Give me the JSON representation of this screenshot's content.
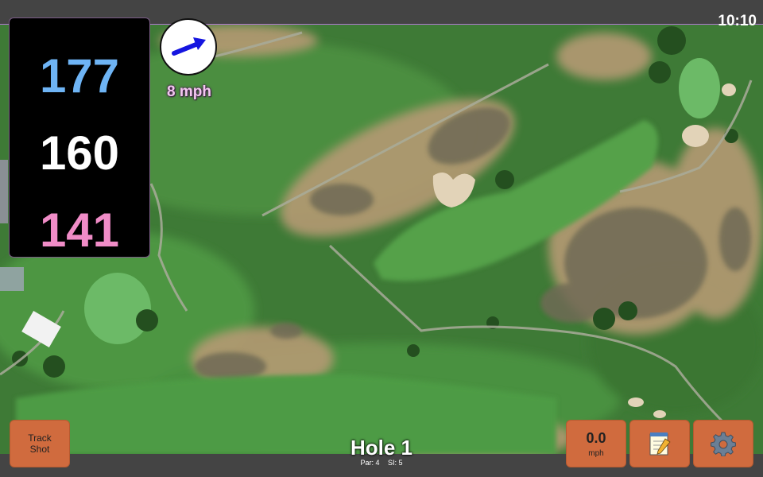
{
  "status": {
    "time": "10:10"
  },
  "distances": {
    "back": "177",
    "center": "160",
    "front": "141"
  },
  "wind": {
    "speed_label": "8 mph",
    "icon": "wind-direction-arrow-icon"
  },
  "controls": {
    "track_shot_line1": "Track",
    "track_shot_line2": "Shot",
    "speed_value": "0.0",
    "speed_unit": "mph",
    "notes_icon": "notepad-icon",
    "settings_icon": "gear-icon"
  },
  "hole": {
    "title": "Hole 1",
    "par": "Par: 4",
    "si": "SI: 5"
  },
  "colors": {
    "back_distance": "#6eb4f5",
    "center_distance": "#ffffff",
    "front_distance": "#f08cc7",
    "button": "#d06b3e",
    "fairway": "#4e9a45",
    "rough": "#3f7d35",
    "bunker": "#d7c3a2"
  }
}
